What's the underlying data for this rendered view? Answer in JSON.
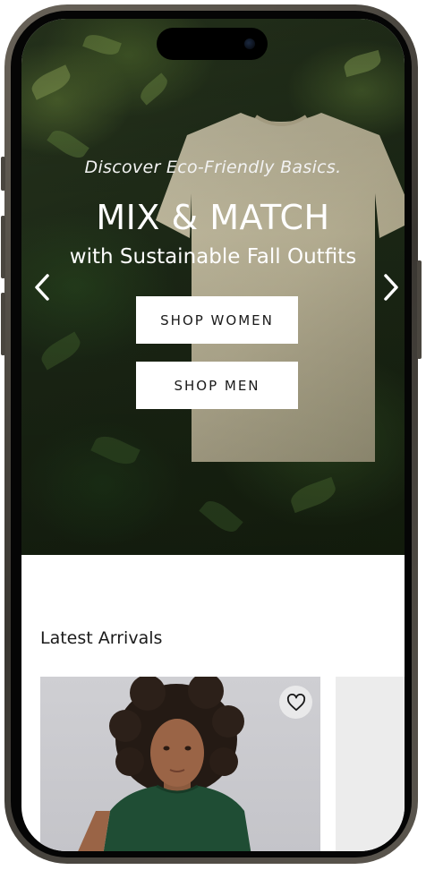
{
  "hero": {
    "tagline": "Discover Eco-Friendly Basics.",
    "headline": "MIX & MATCH",
    "subheadline": "with Sustainable Fall Outfits",
    "prev_icon": "chevron-left-icon",
    "next_icon": "chevron-right-icon",
    "buttons": {
      "women": "SHOP WOMEN",
      "men": "SHOP MEN"
    }
  },
  "latest": {
    "title": "Latest Arrivals",
    "favorite_icon": "heart-outline-icon"
  },
  "colors": {
    "button_bg": "#ffffff",
    "button_text": "#1a1a1a",
    "hero_text": "#ffffff"
  }
}
